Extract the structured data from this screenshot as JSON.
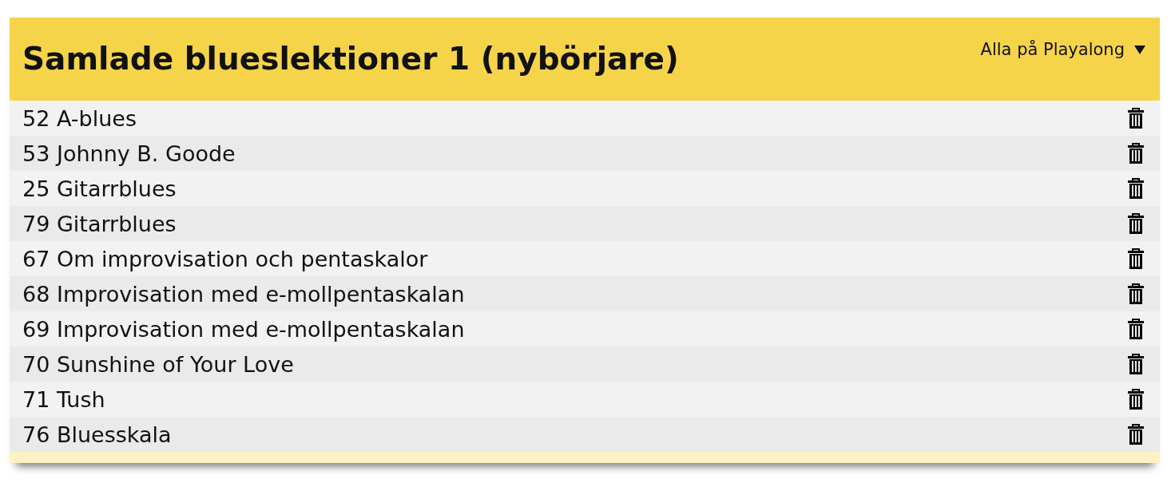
{
  "header": {
    "title": "Samlade blueslektioner 1 (nybörjare)",
    "menu": {
      "label": "Alla på Playalong"
    }
  },
  "lessons": [
    {
      "label": "52 A-blues"
    },
    {
      "label": "53 Johnny B. Goode"
    },
    {
      "label": "25 Gitarrblues"
    },
    {
      "label": "79 Gitarrblues"
    },
    {
      "label": "67 Om improvisation och pentaskalor"
    },
    {
      "label": "68 Improvisation med e-mollpentaskalan"
    },
    {
      "label": "69 Improvisation med e-mollpentaskalan"
    },
    {
      "label": "70 Sunshine of Your Love"
    },
    {
      "label": "71 Tush"
    },
    {
      "label": "76 Bluesskala"
    }
  ]
}
